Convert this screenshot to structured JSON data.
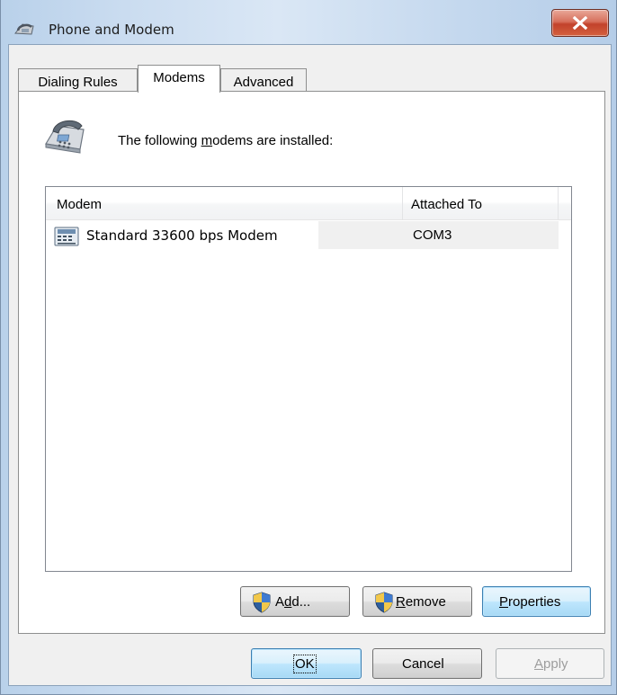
{
  "window": {
    "title": "Phone and Modem",
    "close_icon": "close-x-icon",
    "title_icon": "phone-and-modem-icon"
  },
  "tabs": [
    {
      "label": "Dialing Rules",
      "active": false
    },
    {
      "label": "Modems",
      "active": true
    },
    {
      "label": "Advanced",
      "active": false
    }
  ],
  "modems_panel": {
    "installed_text_pre": "The following ",
    "installed_text_accel": "m",
    "installed_text_post": "odems are installed:",
    "list": {
      "columns": [
        "Modem",
        "Attached To"
      ],
      "rows": [
        {
          "modem": "Standard 33600 bps Modem",
          "attached_to": "COM3",
          "icon": "modem-icon"
        }
      ]
    },
    "buttons": {
      "add": {
        "pre": "A",
        "accel": "d",
        "post": "d...",
        "icon": "uac-shield-icon"
      },
      "remove": {
        "pre": "",
        "accel": "R",
        "post": "emove",
        "icon": "uac-shield-icon"
      },
      "properties": {
        "pre": "",
        "accel": "P",
        "post": "roperties"
      }
    }
  },
  "dialog_buttons": {
    "ok": "OK",
    "cancel": "Cancel",
    "apply_accel": "A",
    "apply_rest": "pply"
  },
  "colors": {
    "title_gradient": "#cadcf0",
    "close_button": "#c2422b",
    "default_button_border": "#3c7fb1"
  }
}
